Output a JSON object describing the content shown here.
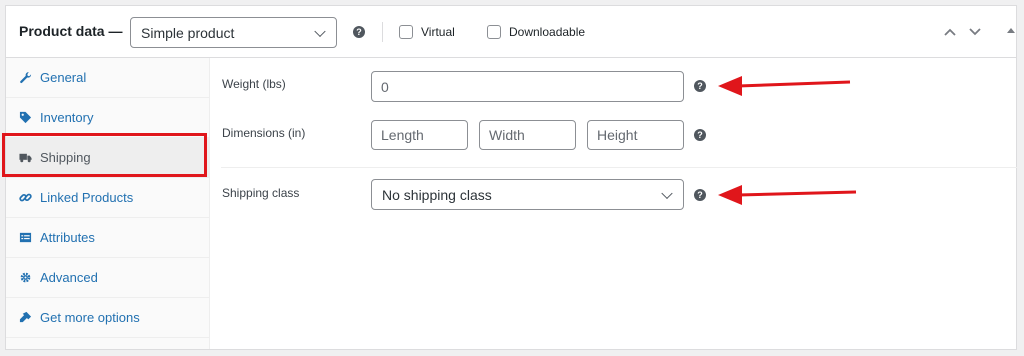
{
  "header": {
    "title": "Product data —",
    "product_type": "Simple product",
    "virtual_label": "Virtual",
    "downloadable_label": "Downloadable"
  },
  "sidebar": {
    "items": [
      {
        "label": "General",
        "icon": "wrench-icon"
      },
      {
        "label": "Inventory",
        "icon": "tag-icon"
      },
      {
        "label": "Shipping",
        "icon": "truck-icon",
        "active": true
      },
      {
        "label": "Linked Products",
        "icon": "link-icon"
      },
      {
        "label": "Attributes",
        "icon": "list-icon"
      },
      {
        "label": "Advanced",
        "icon": "gear-icon"
      },
      {
        "label": "Get more options",
        "icon": "plugin-icon"
      }
    ]
  },
  "shipping": {
    "weight_label": "Weight (lbs)",
    "weight_placeholder": "0",
    "dimensions_label": "Dimensions (in)",
    "length_placeholder": "Length",
    "width_placeholder": "Width",
    "height_placeholder": "Height",
    "shipping_class_label": "Shipping class",
    "shipping_class_value": "No shipping class"
  },
  "help_glyph": "?",
  "colors": {
    "link": "#2271b1",
    "annotation": "#e0161b",
    "border": "#8c8f94"
  }
}
